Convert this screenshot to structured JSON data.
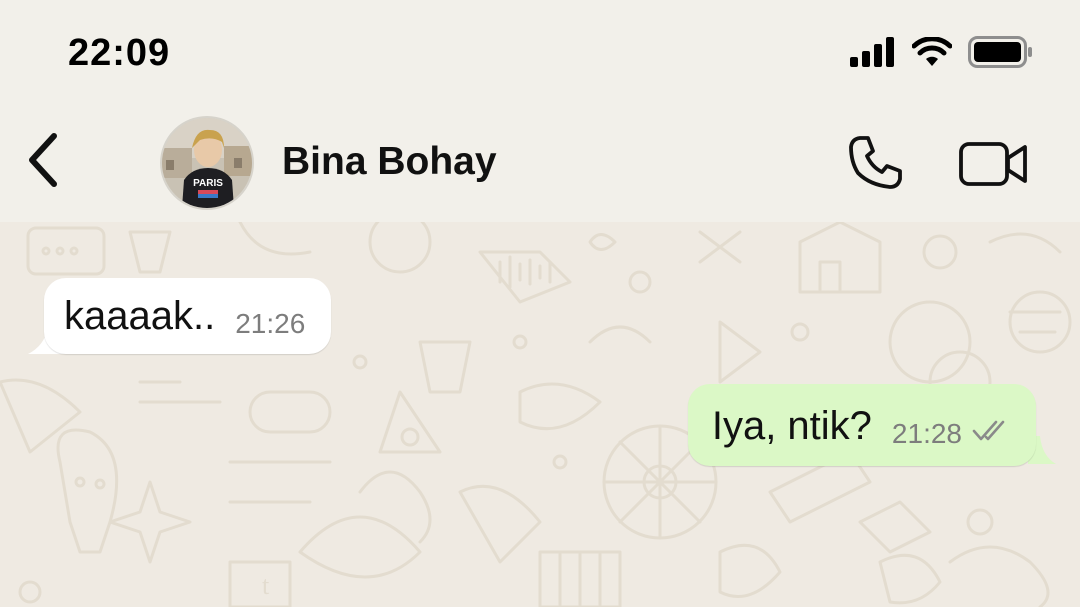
{
  "status_bar": {
    "time": "22:09",
    "icons": [
      "cellular-signal-icon",
      "wifi-icon",
      "battery-icon"
    ]
  },
  "header": {
    "contact_name": "Bina Bohay",
    "icons": [
      "back-chevron-icon",
      "phone-icon",
      "video-camera-icon"
    ]
  },
  "messages": [
    {
      "direction": "incoming",
      "text": "kaaaak..",
      "time": "21:26"
    },
    {
      "direction": "outgoing",
      "text": "Iya, ntik?",
      "time": "21:28",
      "status": "double-check-read-icon"
    }
  ],
  "colors": {
    "background": "#f2f0ea",
    "chat_wallpaper": "#efeae2",
    "incoming_bubble": "#ffffff",
    "outgoing_bubble": "#dbf8c6",
    "timestamp": "#7d7d7d"
  }
}
